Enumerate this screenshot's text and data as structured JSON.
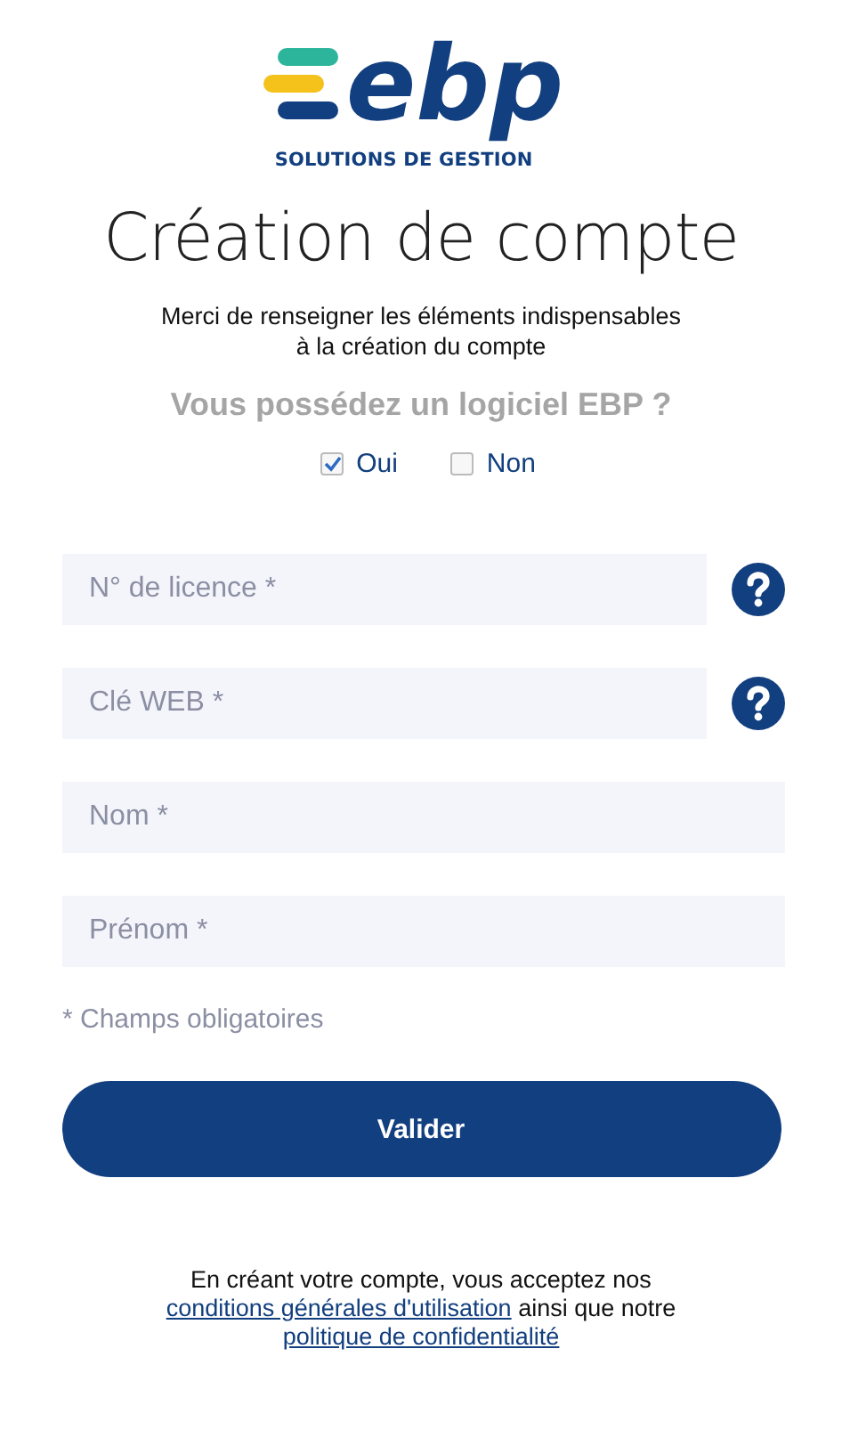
{
  "logo": {
    "wordmark": "ebp",
    "tagline": "SOLUTIONS DE GESTION"
  },
  "title": "Création de compte",
  "intro": "Merci de renseigner les éléments indispensables\nà la création du compte",
  "question": "Vous possédez un logiciel EBP ?",
  "options": [
    {
      "label": "Oui",
      "selected": true
    },
    {
      "label": "Non",
      "selected": false
    }
  ],
  "fields": [
    {
      "placeholder": "N° de licence *",
      "help": true
    },
    {
      "placeholder": "Clé WEB *",
      "help": true
    },
    {
      "placeholder": "Nom *",
      "help": false
    },
    {
      "placeholder": "Prénom *",
      "help": false
    }
  ],
  "required_note": "* Champs obligatoires",
  "submit": "Valider",
  "footer": [
    {
      "kind": "text",
      "text": "En créant votre compte, vous acceptez nos "
    },
    {
      "kind": "link",
      "text": "conditions générales d'utilisation"
    },
    {
      "kind": "text",
      "text": " ainsi que notre "
    },
    {
      "kind": "link",
      "text": "politique de confidentialité"
    }
  ]
}
